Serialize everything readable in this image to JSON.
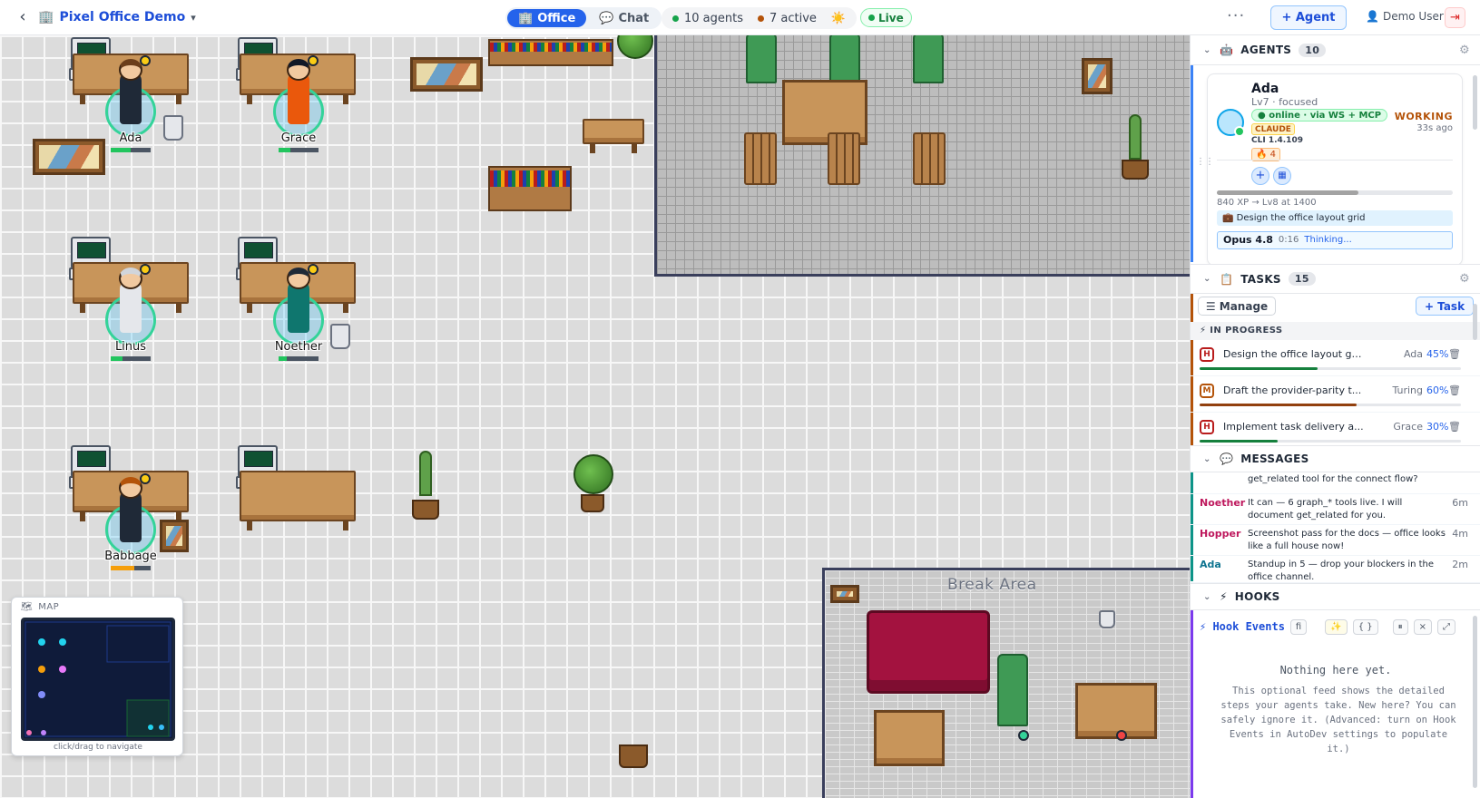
{
  "topbar": {
    "back_icon": "chevron-left-icon",
    "workspace_icon": "building-icon",
    "workspace_glyph": "🏢",
    "workspace_name": "Pixel Office Demo",
    "views": [
      {
        "label": "Office",
        "glyph": "🏢",
        "active": true
      },
      {
        "label": "Chat",
        "glyph": "💬",
        "active": false
      }
    ],
    "agents_count": "10 agents",
    "active_count": "7 active",
    "weather_glyph": "☀️",
    "live_label": "Live",
    "more_glyph": "···",
    "add_agent_label": "+ Agent",
    "user_glyph": "👤",
    "user_name": "Demo User",
    "logout_glyph": "⇥",
    "colors": {
      "accent": "#2563eb",
      "live": "#15803d",
      "agents_dot": "#16a34a",
      "active_dot": "#b45309"
    }
  },
  "office": {
    "agents": [
      {
        "name": "Ada",
        "shirt": "#1f2937",
        "hair": "#6b3e1b",
        "progress": 0.5
      },
      {
        "name": "Grace",
        "shirt": "#ea580c",
        "hair": "#111827",
        "progress": 0.3
      },
      {
        "name": "Linus",
        "shirt": "#e5e7eb",
        "hair": "#d1d5db",
        "progress": 0.3
      },
      {
        "name": "Noether",
        "shirt": "#0f766e",
        "hair": "#1f2937",
        "progress": 0.2
      },
      {
        "name": "Babbage",
        "shirt": "#1f2937",
        "hair": "#b45309",
        "progress": 0.6
      }
    ],
    "break_area_label": "Break Area"
  },
  "minimap": {
    "glyph": "🗺",
    "title": "MAP",
    "hint": "click/drag to navigate"
  },
  "panel": {
    "agents": {
      "header": "AGENTS",
      "icon": "robot-icon",
      "glyph": "🤖",
      "count": "10",
      "card": {
        "name": "Ada",
        "level": "Lv7 · focused",
        "online": "● online · via WS + MCP",
        "provider": "CLAUDE",
        "cli": "CLI 1.4.109",
        "streak": "🔥 4",
        "status": "WORKING",
        "ago": "33s ago",
        "xp": "840 XP → Lv8 at 1400",
        "xp_fraction": 0.6,
        "task": "💼 Design the office layout grid",
        "model": "Opus 4.8",
        "timer": "0:16",
        "thinking": "Thinking..."
      }
    },
    "tasks": {
      "header": "TASKS",
      "glyph": "📋",
      "count": "15",
      "manage_label": "☰ Manage",
      "add_task_label": "+ Task",
      "group_label": "⚡ IN PROGRESS",
      "items": [
        {
          "priority": "H",
          "title": "Design the office layout grid",
          "assignee": "Ada",
          "percent": "45%",
          "progress": 0.45,
          "bar_color": "#15803d"
        },
        {
          "priority": "M",
          "title": "Draft the provider-parity t...",
          "assignee": "Turing",
          "percent": "60%",
          "progress": 0.6,
          "bar_color": "#92400e"
        },
        {
          "priority": "H",
          "title": "Implement task delivery a...",
          "assignee": "Grace",
          "percent": "30%",
          "progress": 0.3,
          "bar_color": "#15803d"
        }
      ]
    },
    "messages": {
      "header": "MESSAGES",
      "glyph": "💬",
      "items": [
        {
          "from": "",
          "text": "get_related tool for the connect flow?",
          "ago": "",
          "color": "#374151"
        },
        {
          "from": "Noether",
          "text": "It can — 6 graph_* tools live. I will document get_related for you.",
          "ago": "6m",
          "color": "#be185d"
        },
        {
          "from": "Hopper",
          "text": "Screenshot pass for the docs — office looks like a full house now!",
          "ago": "4m",
          "color": "#be185d"
        },
        {
          "from": "Ada",
          "text": "Standup in 5 — drop your blockers in the office channel.",
          "ago": "2m",
          "color": "#0e7490"
        }
      ]
    },
    "hooks": {
      "header": "HOOKS",
      "glyph": "⚡",
      "bar_title": "⚡ Hook Events",
      "filter_label": "fi",
      "chips": [
        "✨",
        "{ }",
        "⏸",
        "×",
        "⤢"
      ],
      "empty_title": "Nothing here yet.",
      "empty_desc": "This optional feed shows the detailed steps your agents take. New here? You can safely ignore it. (Advanced: turn on Hook Events in AutoDev settings to populate it.)"
    }
  }
}
